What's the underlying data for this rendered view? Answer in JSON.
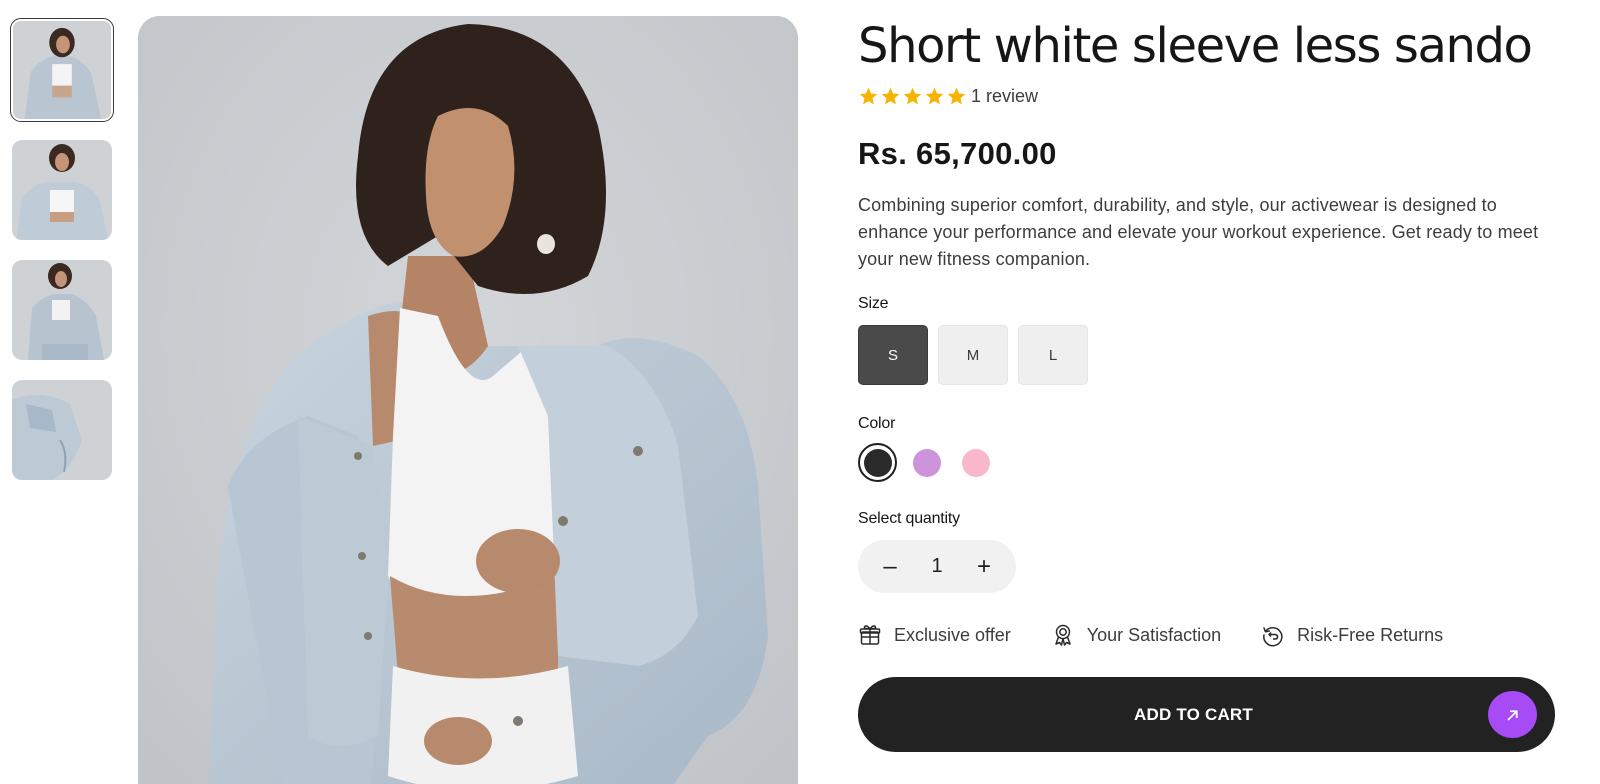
{
  "product": {
    "title": "Short white sleeve less sando",
    "rating": {
      "stars": 5,
      "review_text": "1 review",
      "star_color": "#f5b400"
    },
    "price": "Rs. 65,700.00",
    "description": "Combining superior comfort, durability, and style, our activewear is designed to enhance your performance and elevate your workout experience. Get ready to meet your new fitness companion."
  },
  "gallery": {
    "thumbnails": [
      {
        "name": "thumbnail-1",
        "selected": true
      },
      {
        "name": "thumbnail-2",
        "selected": false
      },
      {
        "name": "thumbnail-3",
        "selected": false
      },
      {
        "name": "thumbnail-4",
        "selected": false
      }
    ]
  },
  "size": {
    "label": "Size",
    "options": [
      "S",
      "M",
      "L"
    ],
    "selected": "S"
  },
  "color": {
    "label": "Color",
    "options": [
      "#2a2a2a",
      "#cd94dc",
      "#f9b8c9"
    ],
    "selected": 0
  },
  "quantity": {
    "label": "Select quantity",
    "minus": "–",
    "value": "1",
    "plus": "+"
  },
  "perks": [
    {
      "icon": "gift-icon",
      "label": "Exclusive offer"
    },
    {
      "icon": "award-icon",
      "label": "Your Satisfaction"
    },
    {
      "icon": "return-icon",
      "label": "Risk-Free Returns"
    }
  ],
  "cart": {
    "label": "ADD TO CART",
    "icon": "arrow-up-right-icon",
    "accent": "#a64bf5"
  }
}
